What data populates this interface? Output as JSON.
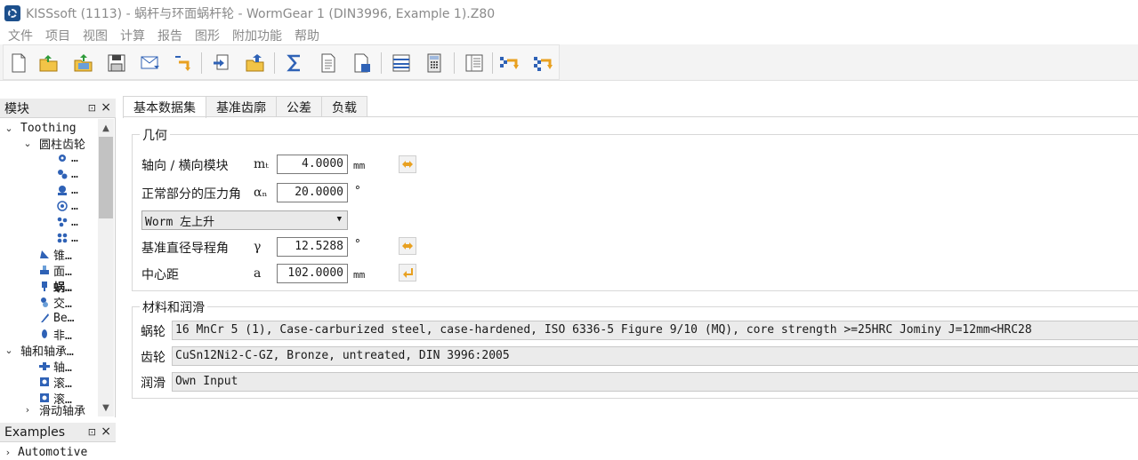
{
  "window": {
    "title": "KISSsoft (1113) - 蜗杆与环面蜗杆轮 - WormGear 1 (DIN3996, Example 1).Z80"
  },
  "menu": [
    "文件",
    "项目",
    "视图",
    "计算",
    "报告",
    "图形",
    "附加功能",
    "帮助"
  ],
  "toolbar": {
    "buttons": [
      "new-file-icon",
      "open-folder-icon",
      "open-project-icon",
      "save-icon",
      "email-icon",
      "undo-icon",
      "import-icon",
      "export-folder-icon",
      "sum-icon",
      "report-icon",
      "report-export-icon",
      "list-icon",
      "calculator-icon",
      "notes-icon",
      "compare-icon",
      "compare-all-icon"
    ]
  },
  "modules_panel": {
    "title": "模块",
    "pin": "⊡",
    "close": "×",
    "tree": [
      {
        "label": "Toothing"
      },
      {
        "label": "圆柱齿轮"
      },
      {
        "label": "…"
      },
      {
        "label": "…"
      },
      {
        "label": "…"
      },
      {
        "label": "…"
      },
      {
        "label": "…"
      },
      {
        "label": "…"
      },
      {
        "label": "锥…"
      },
      {
        "label": "面…"
      },
      {
        "label": "蜗…"
      },
      {
        "label": "交…"
      },
      {
        "label": "Be…"
      },
      {
        "label": "非…"
      },
      {
        "label": "轴和轴承…"
      },
      {
        "label": "轴…"
      },
      {
        "label": "滚…"
      },
      {
        "label": "滚…"
      },
      {
        "label": "滑动轴承"
      }
    ]
  },
  "examples_panel": {
    "title": "Examples",
    "pin": "⊡",
    "close": "×",
    "first_item": "Automotive"
  },
  "tabs": [
    "基本数据集",
    "基准齿廓",
    "公差",
    "负载"
  ],
  "geometry": {
    "title": "几何",
    "module": {
      "label": "轴向 / 横向模块",
      "symbol": "mₜ",
      "value": "4.0000",
      "unit": "mm"
    },
    "pressure_angle": {
      "label": "正常部分的压力角",
      "symbol": "αₙ",
      "value": "20.0000",
      "unit": "°"
    },
    "hand": {
      "value": "Worm 左上升"
    },
    "lead_angle": {
      "label": "基准直径导程角",
      "symbol": "γ",
      "value": "12.5288",
      "unit": "°"
    },
    "center_distance": {
      "label": "中心距",
      "symbol": "a",
      "value": "102.0000",
      "unit": "mm"
    }
  },
  "materials": {
    "title": "材料和润滑",
    "worm": {
      "label": "蜗轮",
      "value": "16 MnCr 5 (1), Case-carburized steel, case-hardened, ISO 6336-5 Figure 9/10 (MQ), core strength >=25HRC Jominy J=12mm<HRC28"
    },
    "gear": {
      "label": "齿轮",
      "value": "CuSn12Ni2-C-GZ, Bronze, untreated, DIN 3996:2005"
    },
    "lubrication": {
      "label": "润滑",
      "value": "Own Input"
    }
  },
  "colors": {
    "accent_orange": "#e8a020",
    "icon_blue": "#2f62b6"
  }
}
